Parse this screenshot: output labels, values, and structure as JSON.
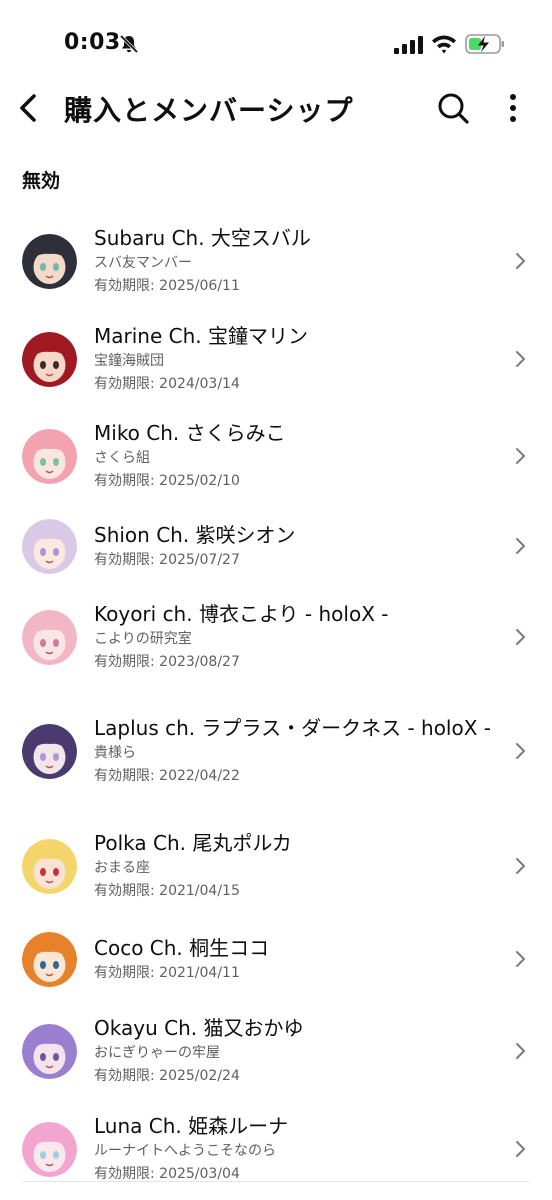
{
  "status_bar": {
    "time": "0:03",
    "icons": [
      "bell-off-icon",
      "signal-icon",
      "wifi-icon",
      "battery-charging-icon"
    ],
    "battery_color": "#4cd964"
  },
  "header": {
    "back_icon": "chevron-left-icon",
    "title": "購入とメンバーシップ",
    "search_icon": "search-icon",
    "more_icon": "more-vert-icon"
  },
  "section": {
    "title": "無効"
  },
  "memberships": [
    {
      "channel": "Subaru Ch. 大空スバル",
      "membership": "スバ友マンバー",
      "expiry": "有効期限: 2025/06/11",
      "avatar_colors": [
        "#2f2f3a",
        "#f3d9c7",
        "#6fb7b0"
      ]
    },
    {
      "channel": "Marine Ch. 宝鐘マリン",
      "membership": "宝鐘海賊団",
      "expiry": "有効期限: 2024/03/14",
      "avatar_colors": [
        "#a01822",
        "#f6d7c8",
        "#3a2a2a"
      ]
    },
    {
      "channel": "Miko Ch. さくらみこ",
      "membership": "さくら組",
      "expiry": "有効期限: 2025/02/10",
      "avatar_colors": [
        "#f3a2b0",
        "#fbe5df",
        "#7cc0a4"
      ]
    },
    {
      "channel": "Shion Ch. 紫咲シオン",
      "membership": "",
      "expiry": "有効期限: 2025/07/27",
      "avatar_colors": [
        "#d9c9e6",
        "#fbe8e0",
        "#b48fd0"
      ]
    },
    {
      "channel": "Koyori ch. 博衣こより - holoX -",
      "membership": "こよりの研究室",
      "expiry": "有効期限: 2023/08/27",
      "avatar_colors": [
        "#f2b7c6",
        "#fbe6e6",
        "#c97d9d"
      ]
    },
    {
      "channel": "Laplus ch. ラプラス・ダークネス - holoX -",
      "membership": "貴様ら",
      "expiry": "有効期限: 2022/04/22",
      "avatar_colors": [
        "#4b3a6e",
        "#f2e6e8",
        "#b196dc"
      ]
    },
    {
      "channel": "Polka Ch. 尾丸ポルカ",
      "membership": "おまる座",
      "expiry": "有効期限: 2021/04/15",
      "avatar_colors": [
        "#f4d56a",
        "#fbe2d4",
        "#c8323a"
      ]
    },
    {
      "channel": "Coco Ch. 桐生ココ",
      "membership": "",
      "expiry": "有効期限: 2021/04/11",
      "avatar_colors": [
        "#e8822a",
        "#fbe5d4",
        "#2d6a9a"
      ]
    },
    {
      "channel": "Okayu Ch. 猫又おかゆ",
      "membership": "おにぎりゃーの牢屋",
      "expiry": "有効期限: 2025/02/24",
      "avatar_colors": [
        "#9a7fd0",
        "#f3e3ec",
        "#6a5a9a"
      ]
    },
    {
      "channel": "Luna Ch. 姫森ルーナ",
      "membership": "ルーナイトへようこそなのら",
      "expiry": "有効期限: 2025/03/04",
      "avatar_colors": [
        "#f2a6cf",
        "#fbe8ec",
        "#9ad0e0"
      ]
    }
  ]
}
